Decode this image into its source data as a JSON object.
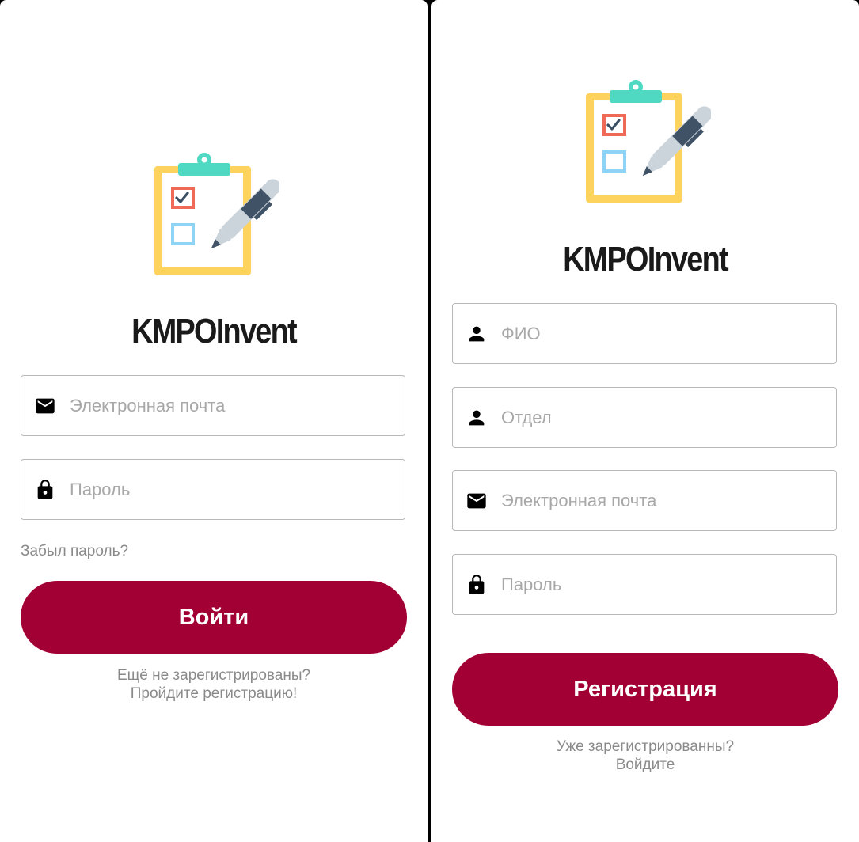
{
  "login": {
    "app_title": "KMPOInvent",
    "email_placeholder": "Электронная почта",
    "password_placeholder": "Пароль",
    "forgot_password": "Забыл пароль?",
    "submit_label": "Войти",
    "register_prompt_line1": "Ещё не зарегистрированы?",
    "register_prompt_line2": "Пройдите регистрацию!"
  },
  "register": {
    "app_title": "KMPOInvent",
    "name_placeholder": "ФИО",
    "department_placeholder": "Отдел",
    "email_placeholder": "Электронная почта",
    "password_placeholder": "Пароль",
    "submit_label": "Регистрация",
    "login_prompt_line1": "Уже зарегистрированны?",
    "login_prompt_line2": "Войдите"
  },
  "icons": {
    "logo": "clipboard-checklist-pen-icon",
    "email": "envelope-icon",
    "password": "lock-icon",
    "name": "person-icon",
    "department": "person-icon"
  },
  "colors": {
    "accent": "#a20034",
    "placeholder": "#a8a8a8",
    "secondary_text": "#8a8a8a",
    "field_border": "#b9b9b9"
  }
}
